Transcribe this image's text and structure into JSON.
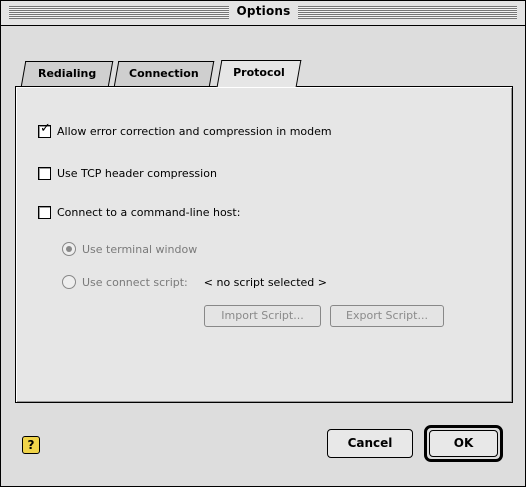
{
  "window": {
    "title": "Options"
  },
  "tabs": [
    {
      "label": "Redialing",
      "active": false
    },
    {
      "label": "Connection",
      "active": false
    },
    {
      "label": "Protocol",
      "active": true
    }
  ],
  "options": {
    "error_correction": {
      "label": "Allow error correction and compression in modem",
      "checked": true
    },
    "tcp_header": {
      "label": "Use TCP header compression",
      "checked": false
    },
    "command_line": {
      "label": "Connect to a command-line host:",
      "checked": false
    },
    "terminal_window": {
      "label": "Use terminal window",
      "selected": true,
      "enabled": false
    },
    "connect_script": {
      "label": "Use connect script:",
      "selected": false,
      "enabled": false
    },
    "script_value": "< no script selected >"
  },
  "buttons": {
    "import": "Import Script...",
    "export": "Export Script...",
    "cancel": "Cancel",
    "ok": "OK"
  },
  "icons": {
    "help": "help-icon",
    "checkmark": "checkmark-icon"
  }
}
